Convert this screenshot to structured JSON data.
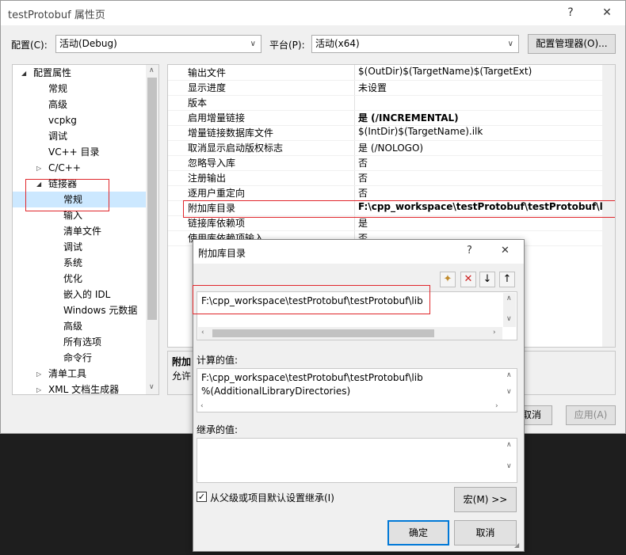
{
  "window": {
    "title": "testProtobuf 属性页",
    "help": "?",
    "close": "✕",
    "config_label": "配置(C):",
    "config_value": "活动(Debug)",
    "platform_label": "平台(P):",
    "platform_value": "活动(x64)",
    "config_manager": "配置管理器(O)...",
    "cancel": "取消",
    "apply": "应用(A)"
  },
  "tree": {
    "items": [
      {
        "label": "配置属性",
        "tri": "◢"
      },
      {
        "label": "常规"
      },
      {
        "label": "高级"
      },
      {
        "label": "vcpkg"
      },
      {
        "label": "调试"
      },
      {
        "label": "VC++ 目录"
      },
      {
        "label": "C/C++",
        "tri": "▷"
      },
      {
        "label": "链接器",
        "tri": "◢"
      },
      {
        "label": "常规"
      },
      {
        "label": "输入"
      },
      {
        "label": "清单文件"
      },
      {
        "label": "调试"
      },
      {
        "label": "系统"
      },
      {
        "label": "优化"
      },
      {
        "label": "嵌入的 IDL"
      },
      {
        "label": "Windows 元数据"
      },
      {
        "label": "高级"
      },
      {
        "label": "所有选项"
      },
      {
        "label": "命令行"
      },
      {
        "label": "清单工具",
        "tri": "▷"
      },
      {
        "label": "XML 文档生成器",
        "tri": "▷"
      }
    ]
  },
  "properties": [
    {
      "name": "输出文件",
      "value": "$(OutDir)$(TargetName)$(TargetExt)"
    },
    {
      "name": "显示进度",
      "value": "未设置"
    },
    {
      "name": "版本",
      "value": ""
    },
    {
      "name": "启用增量链接",
      "value": "是 (/INCREMENTAL)"
    },
    {
      "name": "增量链接数据库文件",
      "value": "$(IntDir)$(TargetName).ilk"
    },
    {
      "name": "取消显示启动版权标志",
      "value": "是 (/NOLOGO)"
    },
    {
      "name": "忽略导入库",
      "value": "否"
    },
    {
      "name": "注册输出",
      "value": "否"
    },
    {
      "name": "逐用户重定向",
      "value": "否"
    },
    {
      "name": "附加库目录",
      "value": "F:\\cpp_workspace\\testProtobuf\\testProtobuf\\lib;%(A"
    },
    {
      "name": "链接库依赖项",
      "value": "是"
    },
    {
      "name": "使用库依赖项输入",
      "value": "否"
    }
  ],
  "description": {
    "title": "附加",
    "text": "允许"
  },
  "dialog": {
    "title": "附加库目录",
    "help": "?",
    "close": "✕",
    "entries": [
      "F:\\cpp_workspace\\testProtobuf\\testProtobuf\\lib"
    ],
    "computed_label": "计算的值:",
    "computed_values": [
      "F:\\cpp_workspace\\testProtobuf\\testProtobuf\\lib",
      "%(AdditionalLibraryDirectories)"
    ],
    "inherited_label": "继承的值:",
    "inherit_checkbox": "从父级或项目默认设置继承(I)",
    "inherit_checked": true,
    "macro_button": "宏(M) >>",
    "ok": "确定",
    "cancel": "取消"
  },
  "colors": {
    "highlight": "#e0262b",
    "selection": "#cce8ff"
  }
}
